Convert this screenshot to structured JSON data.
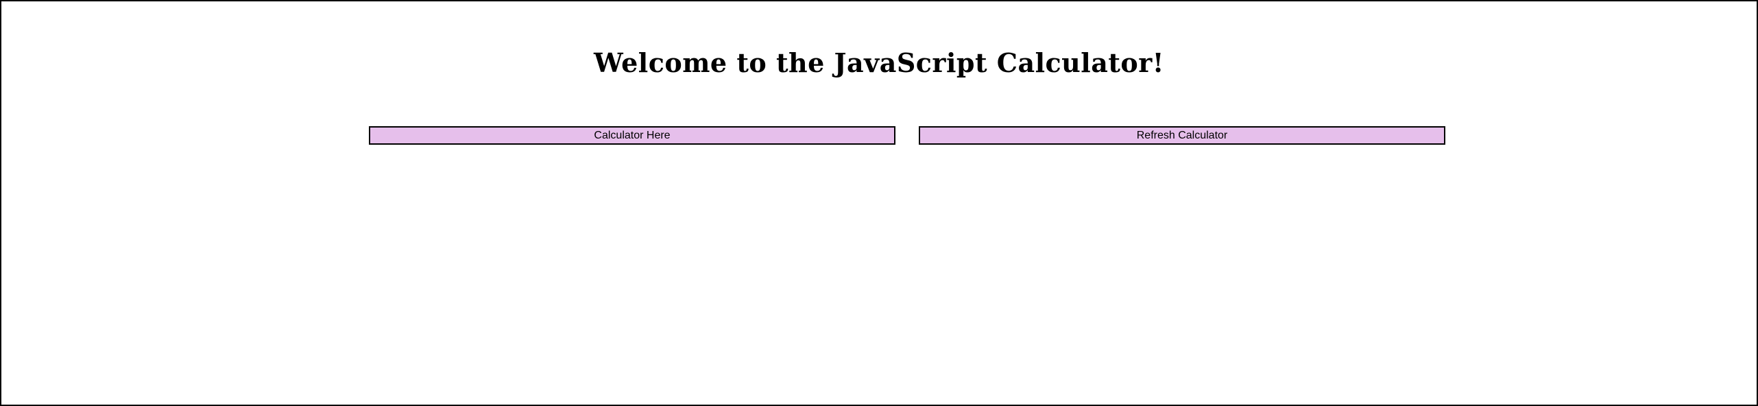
{
  "header": {
    "title": "Welcome to the JavaScript Calculator!"
  },
  "buttons": {
    "calculator_label": "Calculator Here",
    "refresh_label": "Refresh Calculator"
  },
  "colors": {
    "button_background": "#e6bfeb",
    "button_border": "#000000",
    "page_border": "#000000",
    "page_background": "#ffffff"
  }
}
